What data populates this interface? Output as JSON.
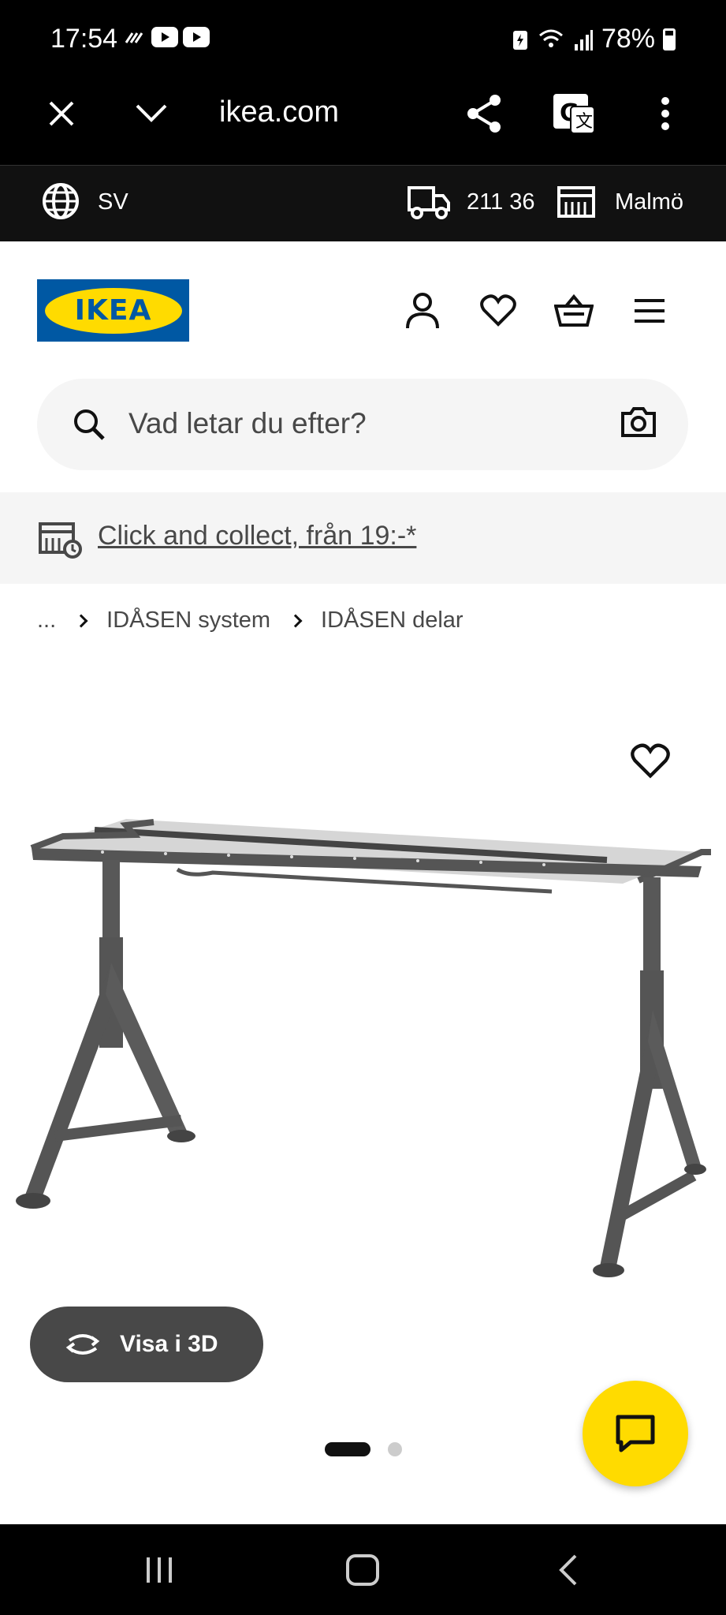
{
  "status_bar": {
    "time": "17:54",
    "battery": "78%"
  },
  "browser": {
    "url": "ikea.com"
  },
  "top_strip": {
    "language": "SV",
    "postal_code": "211 36",
    "store": "Malmö"
  },
  "header": {
    "logo_text": "IKEA"
  },
  "search": {
    "placeholder": "Vad letar du efter?"
  },
  "promo": {
    "text": "Click and collect, från 19:-*"
  },
  "breadcrumb": {
    "ellipsis": "...",
    "items": [
      "IDÅSEN system",
      "IDÅSEN delar"
    ]
  },
  "product": {
    "view_3d_label": "Visa i 3D",
    "image_count": 2,
    "current_image": 1
  },
  "colors": {
    "ikea_blue": "#0058a3",
    "ikea_yellow": "#ffdb00",
    "dark_grey": "#484848"
  }
}
